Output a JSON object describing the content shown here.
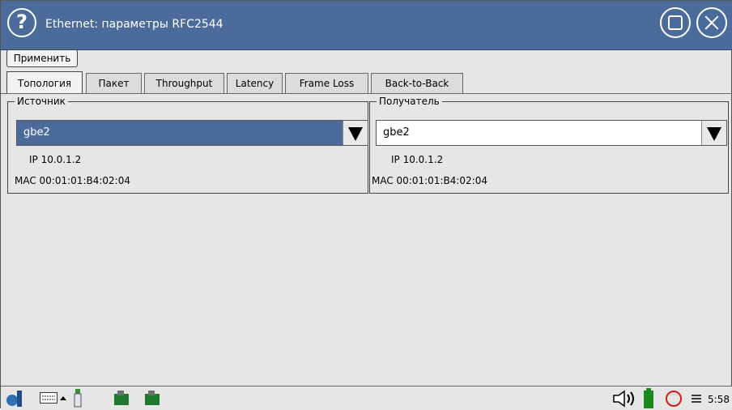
{
  "window": {
    "title": "Ethernet: параметры RFC2544",
    "help_icon": "?"
  },
  "toolbar": {
    "apply_label": "Применить"
  },
  "tabs": [
    {
      "label": "Топология",
      "active": true
    },
    {
      "label": "Пакет"
    },
    {
      "label": "Throughput"
    },
    {
      "label": "Latency"
    },
    {
      "label": "Frame Loss"
    },
    {
      "label": "Back-to-Back"
    }
  ],
  "source": {
    "legend": "Источник",
    "interface": "gbe2",
    "ip": "IP 10.0.1.2",
    "mac": "MAC 00:01:01:B4:02:04"
  },
  "destination": {
    "legend": "Получатель",
    "interface": "gbe2",
    "ip": "IP 10.0.1.2",
    "mac": "MAC 00:01:01:B4:02:04"
  },
  "taskbar": {
    "icons": [
      "start-icon",
      "keyboard-icon",
      "usb-icon",
      "network-icon",
      "network-icon",
      "volume-icon",
      "battery-icon",
      "record-icon"
    ],
    "clock": "5:58"
  },
  "colors": {
    "accent": "#4b6b9b",
    "background": "#e6e6e6"
  }
}
